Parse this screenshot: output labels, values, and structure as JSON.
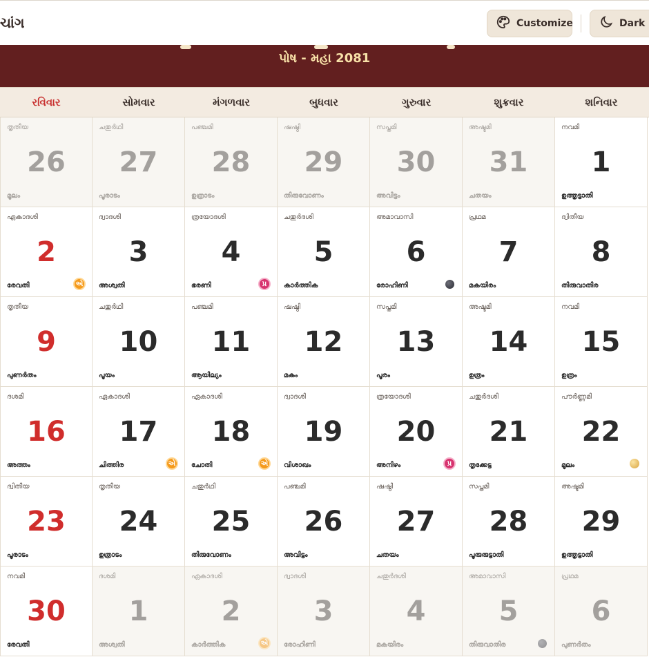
{
  "app": {
    "title": "ચાંગ"
  },
  "toolbar": {
    "customize_label": "Customize",
    "dark_label": "Dark"
  },
  "banner": {
    "subtitle": "પોષ - મહા 2081"
  },
  "weekdays": [
    "રવિવાર",
    "સોમવાર",
    "મંગળવાર",
    "બુધવાર",
    "ગુરુવાર",
    "શુક્રવાર",
    "શનિવાર"
  ],
  "days": [
    {
      "date": "26",
      "tithi": "തൃതീയ",
      "nakshatra": "മൂലം",
      "out": true
    },
    {
      "date": "27",
      "tithi": "ചതുർഥി",
      "nakshatra": "പൂരാടം",
      "out": true
    },
    {
      "date": "28",
      "tithi": "പഞ്ചമി",
      "nakshatra": "ഉത്രാടം",
      "out": true
    },
    {
      "date": "29",
      "tithi": "ഷഷ്ഠി",
      "nakshatra": "തിരുവോണം",
      "out": true
    },
    {
      "date": "30",
      "tithi": "സപ്തമി",
      "nakshatra": "അവിട്ടം",
      "out": true
    },
    {
      "date": "31",
      "tithi": "അഷ്ടമി",
      "nakshatra": "ചതയം",
      "out": true
    },
    {
      "date": "1",
      "tithi": "നവമി",
      "nakshatra": "ഉത്തൃട്ടാതി",
      "out": false
    },
    {
      "date": "2",
      "tithi": "ഏകാദശി",
      "nakshatra": "രേവതി",
      "badge": "ekadashi",
      "badge_text": "એ"
    },
    {
      "date": "3",
      "tithi": "ദ്വാദശി",
      "nakshatra": "അശ്വതി"
    },
    {
      "date": "4",
      "tithi": "ത്രയോദശി",
      "nakshatra": "ഭരണി",
      "badge": "pradosh",
      "badge_text": "પ્ર"
    },
    {
      "date": "5",
      "tithi": "ചതുർദശി",
      "nakshatra": "കാർത്തിക"
    },
    {
      "date": "6",
      "tithi": "അമാവാസി",
      "nakshatra": "രോഹിണി",
      "badge": "newmoon"
    },
    {
      "date": "7",
      "tithi": "പ്രഥമ",
      "nakshatra": "മകയിരം"
    },
    {
      "date": "8",
      "tithi": "ദ്വിതീയ",
      "nakshatra": "തിരുവാതിര"
    },
    {
      "date": "9",
      "tithi": "തൃതീയ",
      "nakshatra": "പുണർതം"
    },
    {
      "date": "10",
      "tithi": "ചതുർഥി",
      "nakshatra": "പൂയം"
    },
    {
      "date": "11",
      "tithi": "പഞ്ചമി",
      "nakshatra": "ആയില്യം"
    },
    {
      "date": "12",
      "tithi": "ഷഷ്ഠി",
      "nakshatra": "മകം"
    },
    {
      "date": "13",
      "tithi": "സപ്തമി",
      "nakshatra": "പൂരം"
    },
    {
      "date": "14",
      "tithi": "അഷ്ടമി",
      "nakshatra": "ഉത്രം"
    },
    {
      "date": "15",
      "tithi": "നവമി",
      "nakshatra": "ഉത്രം"
    },
    {
      "date": "16",
      "tithi": "ദശമി",
      "nakshatra": "അത്തം"
    },
    {
      "date": "17",
      "tithi": "ഏകാദശി",
      "nakshatra": "ചിത്തിര",
      "badge": "ekadashi",
      "badge_text": "એ"
    },
    {
      "date": "18",
      "tithi": "ഏകാദശി",
      "nakshatra": "ചോതി",
      "badge": "ekadashi",
      "badge_text": "એ"
    },
    {
      "date": "19",
      "tithi": "ദ്വാദശി",
      "nakshatra": "വിശാഖം"
    },
    {
      "date": "20",
      "tithi": "ത്രയോദശി",
      "nakshatra": "അനിഴം",
      "badge": "pradosh",
      "badge_text": "પ્ર"
    },
    {
      "date": "21",
      "tithi": "ചതുർദശി",
      "nakshatra": "തൃക്കേട്ട"
    },
    {
      "date": "22",
      "tithi": "പൗർണ്ണമി",
      "nakshatra": "മൂലം",
      "badge": "fullmoon"
    },
    {
      "date": "23",
      "tithi": "ദ്വിതീയ",
      "nakshatra": "പൂരാടം"
    },
    {
      "date": "24",
      "tithi": "തൃതീയ",
      "nakshatra": "ഉത്രാടം"
    },
    {
      "date": "25",
      "tithi": "ചതുർഥി",
      "nakshatra": "തിരുവോണം"
    },
    {
      "date": "26",
      "tithi": "പഞ്ചമി",
      "nakshatra": "അവിട്ടം"
    },
    {
      "date": "27",
      "tithi": "ഷഷ്ഠി",
      "nakshatra": "ചതയം"
    },
    {
      "date": "28",
      "tithi": "സപ്തമി",
      "nakshatra": "പൂരുരുട്ടാതി"
    },
    {
      "date": "29",
      "tithi": "അഷ്ടമി",
      "nakshatra": "ഉത്തൃട്ടാതി"
    },
    {
      "date": "30",
      "tithi": "നവമി",
      "nakshatra": "രേവതി",
      "out": false
    },
    {
      "date": "1",
      "tithi": "ദശമി",
      "nakshatra": "അശ്വതി",
      "out": true
    },
    {
      "date": "2",
      "tithi": "ഏകാദശി",
      "nakshatra": "കാർത്തിക",
      "out": true,
      "badge": "ekadashi",
      "badge_text": "એ"
    },
    {
      "date": "3",
      "tithi": "ദ്വാദശി",
      "nakshatra": "രോഹിണി",
      "out": true
    },
    {
      "date": "4",
      "tithi": "ചതുർദശി",
      "nakshatra": "മകയിരം",
      "out": true
    },
    {
      "date": "5",
      "tithi": "അമാവാസി",
      "nakshatra": "തിരുവാതിര",
      "out": true,
      "badge": "newmoon"
    },
    {
      "date": "6",
      "tithi": "പ്രഥമ",
      "nakshatra": "പുണർതം",
      "out": true
    }
  ]
}
